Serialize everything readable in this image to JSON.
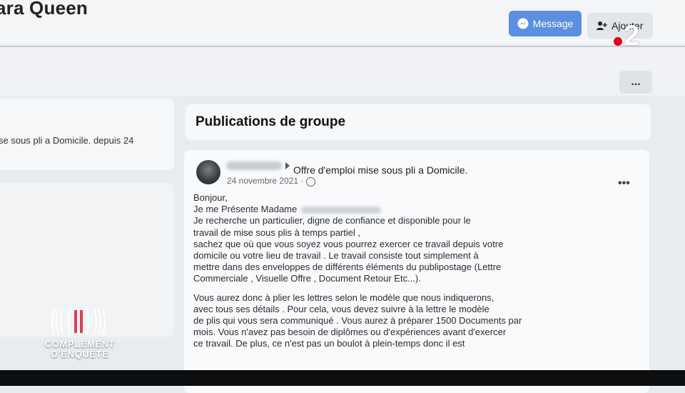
{
  "header": {
    "profile_name": "ara Queen",
    "message_button": "Message",
    "add_button": "Ajouter",
    "more_label": "..."
  },
  "left_column": {
    "snippet": "se sous pli a Domicile. depuis 24"
  },
  "group_section": {
    "title": "Publications de groupe"
  },
  "post": {
    "group_link": "Offre d'emploi mise sous pli a Domicile.",
    "date": "24 novembre 2021 ·",
    "more_label": "•••",
    "lines_block1": [
      "Bonjour,",
      "Je me Présente Madame",
      "Je recherche un particulier, digne de confiance et disponible pour le",
      "travail de mise sous plis à temps partiel ,",
      "sachez que où que vous soyez vous pourrez exercer ce travail depuis votre",
      "domicile ou votre lieu de travail . Le travail consiste tout simplement à",
      "mettre dans des enveloppes de différents éléments du publipostage (Lettre",
      "Commerciale , Visuelle Offre , Document Retour Etc...)."
    ],
    "lines_block2": [
      "Vous aurez donc à plier les lettres selon le modèle que nous indiquerons,",
      "avec tous ses détails . Pour cela, vous devez suivre à la lettre le modèle",
      "de plis qui vous sera communiqué . Vous aurez à préparer 1500 Documents par",
      "mois. Vous n'avez pas besoin de diplômes ou d'expériences avant d'exercer",
      "ce travail. De plus, ce n'est pas un boulot à plein-temps donc il est"
    ]
  },
  "overlay": {
    "channel_number": "2",
    "show_line1": "COMPLEMENT",
    "show_line2": "D'ENQUÊTE"
  },
  "colors": {
    "message_button": "#5b8fe0",
    "channel_dot": "#e0001a"
  }
}
